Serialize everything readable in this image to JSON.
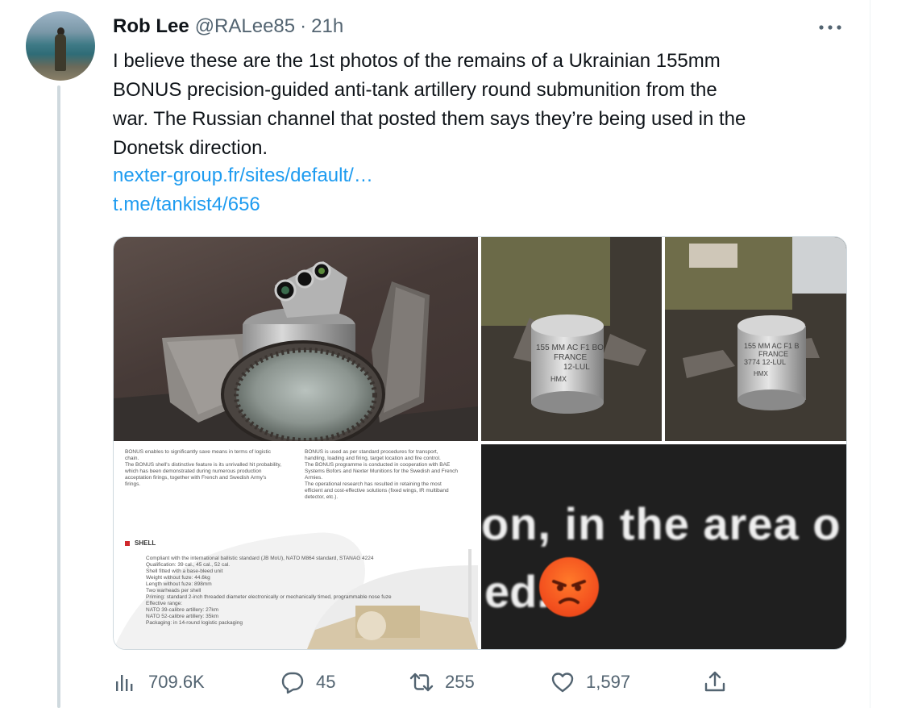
{
  "tweet": {
    "author_name": "Rob Lee",
    "handle": "@RALee85",
    "separator": "·",
    "time": "21h",
    "text_lines": [
      "I believe these are the 1st photos of the remains of a Ukrainian 155mm",
      "BONUS precision-guided anti-tank artillery round submunition from the",
      "war. The Russian channel that posted them says they’re being used in the",
      "Donetsk direction."
    ],
    "links": [
      "nexter-group.fr/sites/default/…",
      "t.me/tankist4/656"
    ]
  },
  "media": {
    "photo2_text": [
      "155 MM AC F1 BO",
      "FRANCE",
      "12-LUL",
      "HMX"
    ],
    "photo3_text": [
      "155 MM AC F1 B",
      "FRANCE",
      "3774  12-LUL",
      "HMX"
    ],
    "doc": {
      "left_col": [
        "BONUS enables to significantly save means in terms of logistic",
        "chain.",
        "",
        "The BONUS shell's distinctive feature is its unrivalled hit probability,",
        "which has been demonstrated during numerous production",
        "acceptation firings, together with French and Swedish Army's",
        "firings."
      ],
      "right_col": [
        "BONUS is used as per standard procedures for transport,",
        "handling, loading and firing, target location and fire control.",
        "",
        "The BONUS programme is conducted in cooperation with BAE",
        "Systems Bofors and Nexter Munitions for the Swedish and French",
        "Armies.",
        "",
        "The operational research has resulted in retaining the most",
        "efficient and cost-effective solutions (fixed wings, IR multiband",
        "detector, etc.)."
      ],
      "shell_heading": "SHELL",
      "shell_bullets": [
        "Compliant with the international ballistic standard (JB MoU), NATO M864 standard, STANAG 4224",
        "Qualification: 39 cal., 45 cal., 52 cal.",
        "Shell fitted with a base-bleed unit",
        "Weight without fuze: 44.6kg",
        "Length without fuze: 898mm",
        "Two warheads per shell",
        "Priming: standard 2-inch threaded diameter electronically or mechanically timed, programmable nose fuze",
        "Effective range:",
        "  NATO 39-calibre artillery: 27km",
        "  NATO 52-calibre artillery: 35km",
        "Packaging: in 14-round logistic packaging"
      ]
    },
    "meme_text_line1": "on, in the area o",
    "meme_text_line2": "ed."
  },
  "actions": {
    "views": "709.6K",
    "replies": "45",
    "retweets": "255",
    "likes": "1,597"
  },
  "colors": {
    "text": "#0f1419",
    "secondary": "#536471",
    "link": "#1d9bf0",
    "border": "#cfd9de"
  }
}
